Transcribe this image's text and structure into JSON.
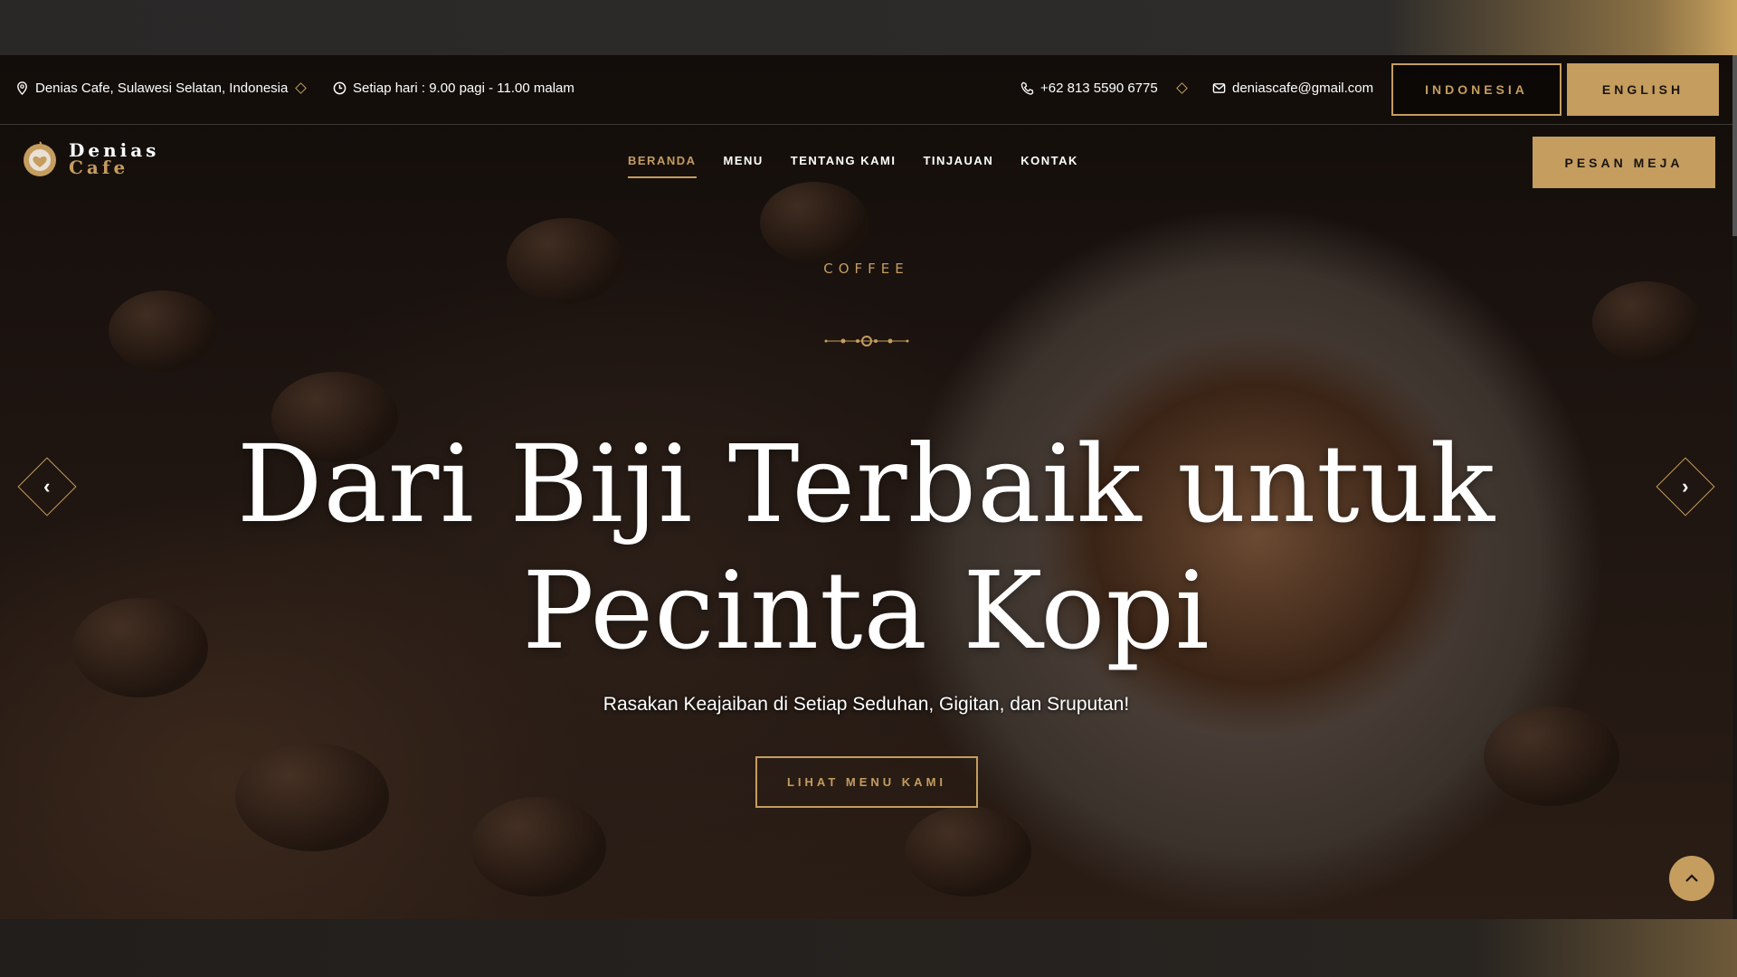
{
  "topbar": {
    "address": "Denias Cafe, Sulawesi Selatan, Indonesia",
    "hours": "Setiap hari : 9.00 pagi - 11.00 malam",
    "phone": "+62 813 5590 6775",
    "email": "deniascafe@gmail.com",
    "lang_id": "INDONESIA",
    "lang_en": "ENGLISH"
  },
  "logo": {
    "line1": "Denias",
    "line2": "Cafe"
  },
  "nav": {
    "items": [
      {
        "label": "BERANDA",
        "active": true
      },
      {
        "label": "MENU"
      },
      {
        "label": "TENTANG KAMI"
      },
      {
        "label": "TINJAUAN"
      },
      {
        "label": "KONTAK"
      }
    ],
    "book_label": "PESAN MEJA"
  },
  "hero": {
    "eyebrow": "COFFEE",
    "title_line1": "Dari Biji Terbaik untuk",
    "title_line2": "Pecinta Kopi",
    "subtitle": "Rasakan Keajaiban di Setiap Seduhan, Gigitan, dan Sruputan!",
    "cta": "LIHAT MENU KAMI",
    "prev_icon": "chevron-left",
    "next_icon": "chevron-right"
  },
  "colors": {
    "accent": "#c59d5f",
    "background": "#1a1410"
  }
}
